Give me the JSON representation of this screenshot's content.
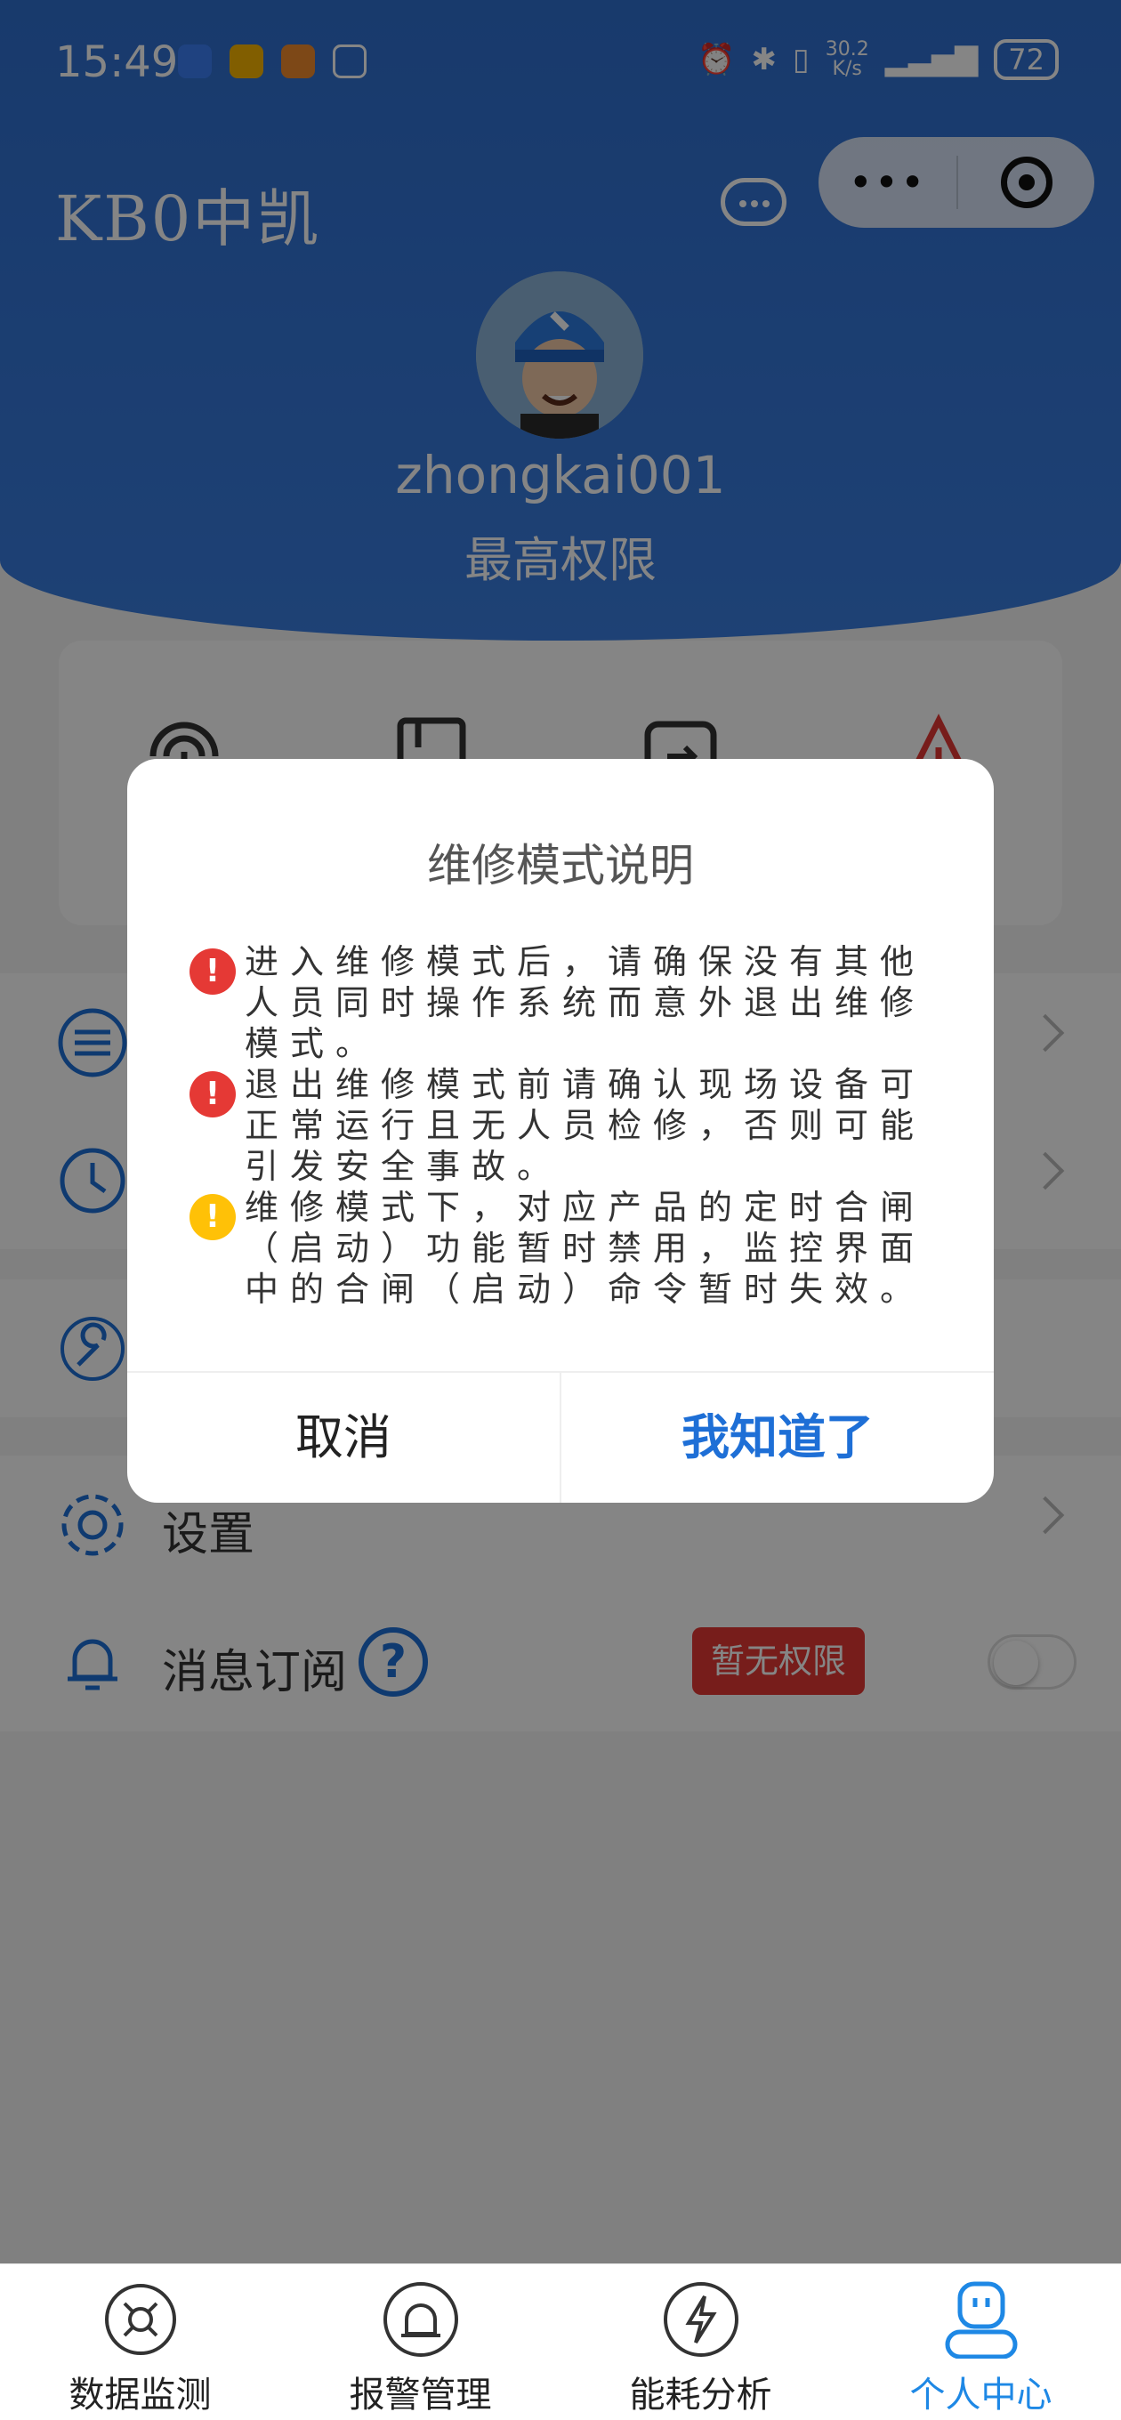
{
  "status_bar": {
    "time": "15:49",
    "speed_value": "30.2",
    "speed_unit": "K/s",
    "battery": "72"
  },
  "header": {
    "app_title": "KB0中凯",
    "username": "zhongkai001",
    "role": "最高权限"
  },
  "menu": {
    "settings_label": "设置",
    "subscribe_label": "消息订阅",
    "help_symbol": "?",
    "no_permission_badge": "暂无权限"
  },
  "dialog": {
    "title": "维修模式说明",
    "notes": [
      {
        "text": "进入维修模式后，请确保没有其他人员同时操作系统而意外退出维修模式。",
        "level": "red"
      },
      {
        "text": "退出维修模式前请确认现场设备可正常运行且无人员检修，否则可能引发安全事故。",
        "level": "red"
      },
      {
        "text": "维修模式下，对应产品的定时合闸（启动）功能暂时禁用，监控界面中的合闸（启动）命令暂时失效。",
        "level": "yellow"
      }
    ],
    "cancel_label": "取消",
    "confirm_label": "我知道了",
    "bullet_symbol": "!"
  },
  "tabbar": {
    "tabs": [
      {
        "label": "数据监测",
        "icon": "monitor-icon"
      },
      {
        "label": "报警管理",
        "icon": "alarm-icon"
      },
      {
        "label": "能耗分析",
        "icon": "energy-icon"
      },
      {
        "label": "个人中心",
        "icon": "profile-icon"
      }
    ],
    "active": "个人中心"
  },
  "colors": {
    "accent": "#1e6fd6",
    "header_blue": "#3a7ee0",
    "danger": "#e53935",
    "warning": "#ffc107"
  }
}
